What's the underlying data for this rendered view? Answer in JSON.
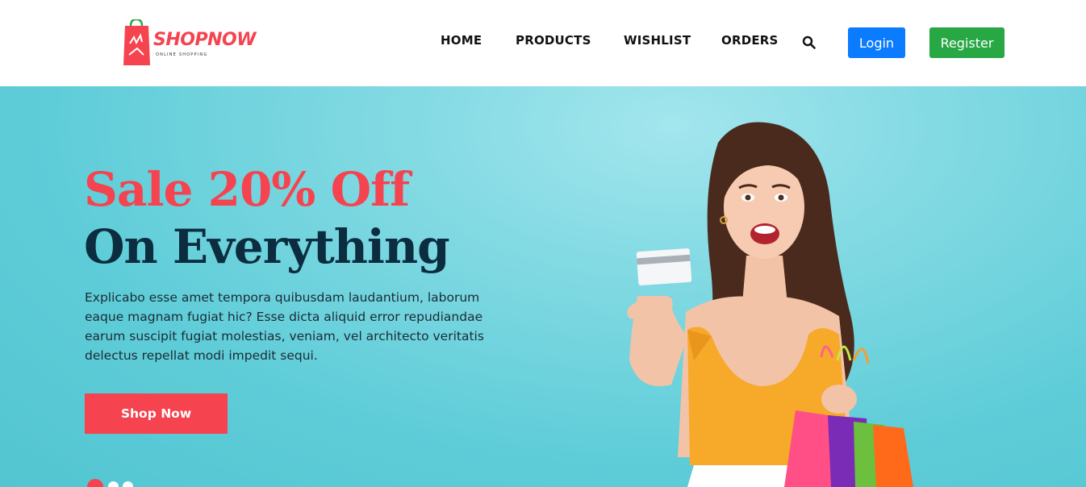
{
  "header": {
    "logo": {
      "name": "SHOPNOW",
      "tagline": "ONLINE SHOPPING"
    },
    "nav": [
      {
        "label": "HOME"
      },
      {
        "label": "PRODUCTS"
      },
      {
        "label": "WISHLIST"
      },
      {
        "label": "ORDERS"
      }
    ],
    "search_icon": "search-icon",
    "login_label": "Login",
    "register_label": "Register"
  },
  "hero": {
    "headline_line1": "Sale 20% Off",
    "headline_line2": "On Everything",
    "description": "Explicabo esse amet tempora quibusdam laudantium, laborum eaque magnam fugiat hic? Esse dicta aliquid error repudiandae earum suscipit fugiat molestias, veniam, vel architecto veritatis delectus repellat modi impedit sequi.",
    "cta_label": "Shop Now",
    "slides_total": 3,
    "active_slide": 1
  },
  "colors": {
    "brand": "#f5434f",
    "headline_dark": "#0b2d3f",
    "login": "#0b7bff",
    "register": "#28a745",
    "hero_bg": "#5fcdd8",
    "dot_inactive": "#ffffff"
  }
}
